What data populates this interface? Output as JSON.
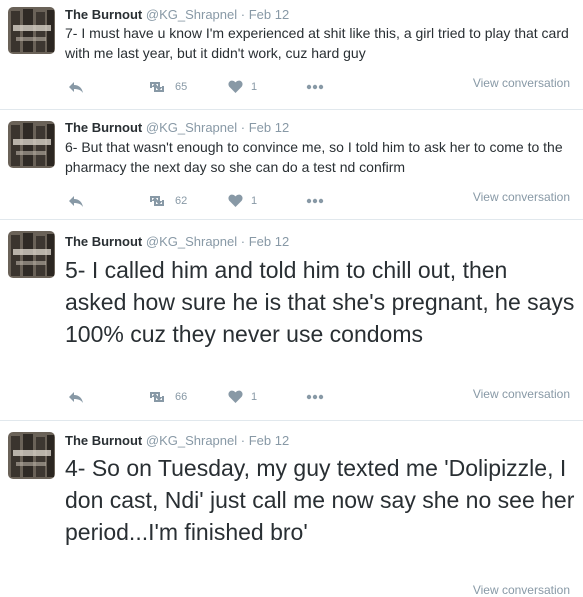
{
  "colors": {
    "text": "#292f33",
    "muted": "#8899a6",
    "divider": "#e1e8ed"
  },
  "icons": {
    "reply": "reply-icon",
    "retweet": "retweet-icon",
    "like": "heart-icon",
    "more": "more-icon"
  },
  "tweets": [
    {
      "author_name": "The Burnout",
      "handle": "@KG_Shrapnel",
      "separator": "·",
      "time": "Feb 12",
      "text": "7- I must have u know I'm experienced at shit like this, a girl tried to play that card with me last year, but it didn't work, cuz hard guy",
      "retweets": "65",
      "likes": "1",
      "view_label": "View conversation"
    },
    {
      "author_name": "The Burnout",
      "handle": "@KG_Shrapnel",
      "separator": "·",
      "time": "Feb 12",
      "text": "6- But that wasn't enough to convince me, so I told him to ask her to come to the pharmacy the next day so she can do a test nd confirm",
      "retweets": "62",
      "likes": "1",
      "view_label": "View conversation"
    },
    {
      "author_name": "The Burnout",
      "handle": "@KG_Shrapnel",
      "separator": "·",
      "time": "Feb 12",
      "text": "5- I called him and told him to chill out, then asked how sure he is that she's pregnant, he says 100% cuz they never use condoms",
      "retweets": "66",
      "likes": "1",
      "view_label": "View conversation"
    },
    {
      "author_name": "The Burnout",
      "handle": "@KG_Shrapnel",
      "separator": "·",
      "time": "Feb 12",
      "text": "4- So on Tuesday, my guy texted me 'Dolipizzle, I don cast, Ndi' just call me now say she no see her period...I'm finished bro'",
      "view_label": "View conversation"
    }
  ]
}
